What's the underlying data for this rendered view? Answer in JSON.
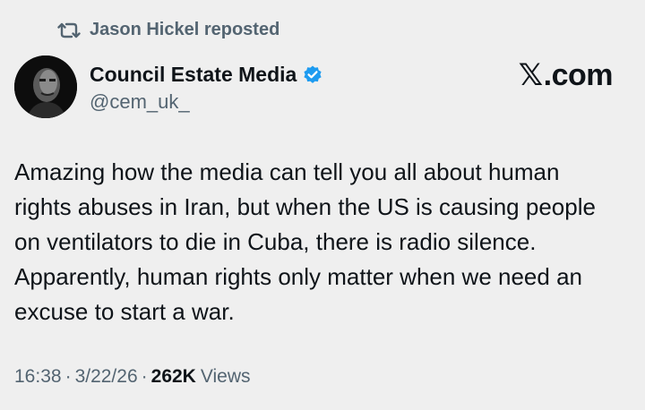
{
  "repost": {
    "icon": "repost-icon",
    "text": "Jason Hickel reposted"
  },
  "author": {
    "display_name": "Council Estate Media",
    "handle": "@cem_uk_",
    "verified_icon": "verified-badge-icon",
    "verified_color": "#1d9bf0"
  },
  "brand": {
    "text": ".com",
    "glyph": "𝕏"
  },
  "tweet": {
    "lines": [
      "Amazing how the media can tell you all about human",
      "rights abuses in Iran, but when the US is causing people",
      "on ventilators to die in Cuba, there is radio silence.",
      "Apparently, human rights only matter when we need an",
      "excuse to start a war."
    ]
  },
  "meta": {
    "time": "16:38",
    "date": "3/22/26",
    "separator": "·",
    "views_count": "262K",
    "views_label": "Views"
  },
  "colors": {
    "background": "#efefef",
    "text": "#0f1419",
    "muted": "#536471",
    "accent": "#1d9bf0"
  }
}
